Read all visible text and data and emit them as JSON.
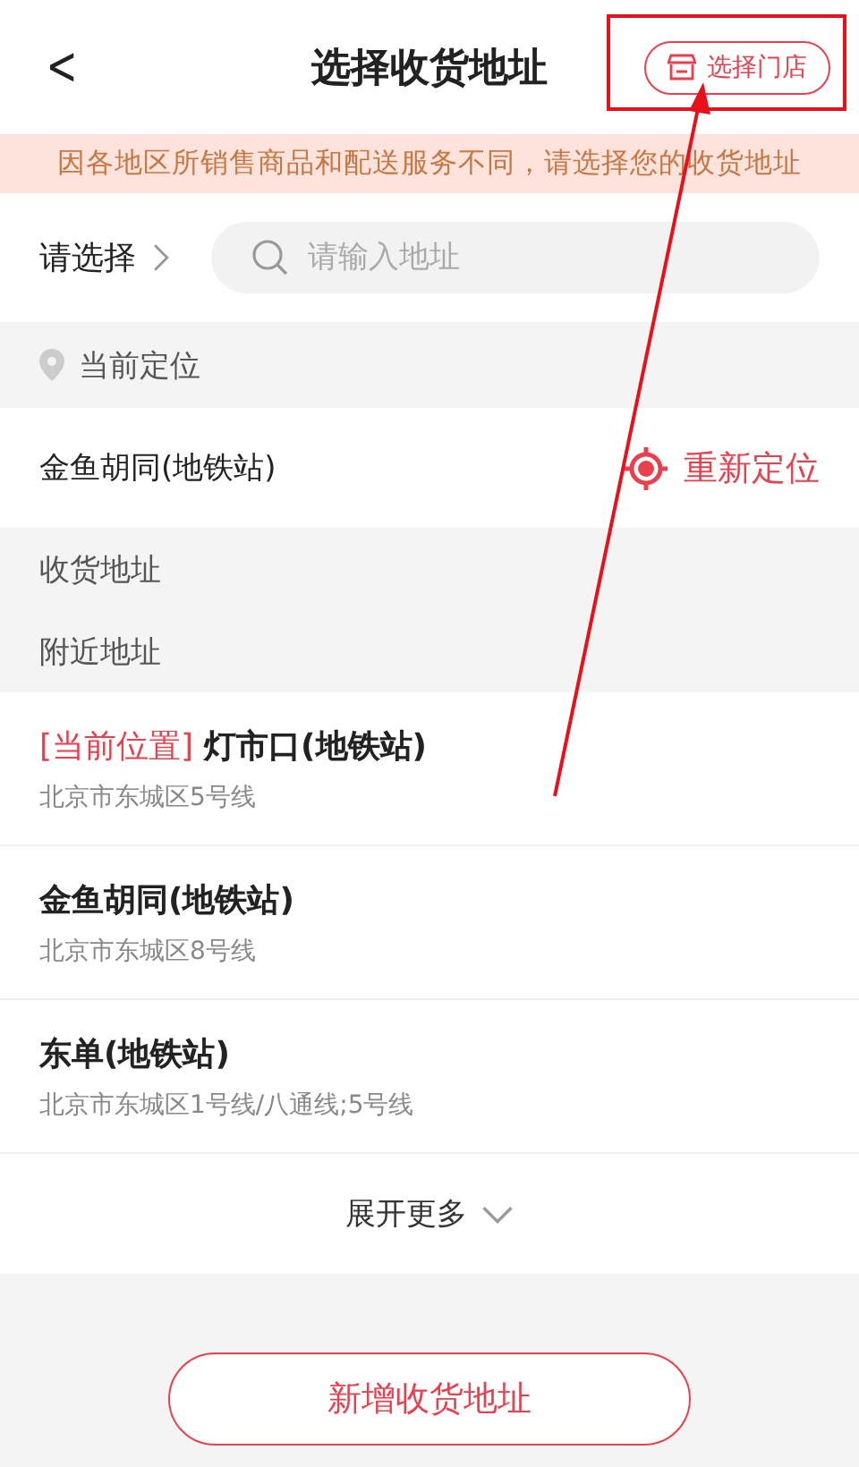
{
  "header": {
    "back": "<",
    "title": "选择收货地址",
    "store_button": "选择门店"
  },
  "notice": "因各地区所销售商品和配送服务不同，请选择您的收货地址",
  "search": {
    "region": "请选择",
    "placeholder": "请输入地址"
  },
  "current_location": {
    "heading": "当前定位",
    "place": "金鱼胡同(地铁站)",
    "relocate": "重新定位"
  },
  "sections": [
    "收货地址",
    "附近地址"
  ],
  "nearby": [
    {
      "tag": "[当前位置]",
      "name": "灯市口(地铁站)",
      "address": "北京市东城区5号线"
    },
    {
      "name": "金鱼胡同(地铁站)",
      "address": "北京市东城区8号线"
    },
    {
      "name": "东单(地铁站)",
      "address": "北京市东城区1号线/八通线;5号线"
    }
  ],
  "expand": "展开更多",
  "add_button": "新增收货地址",
  "annotation": {
    "kind": "arrow-to-box"
  }
}
